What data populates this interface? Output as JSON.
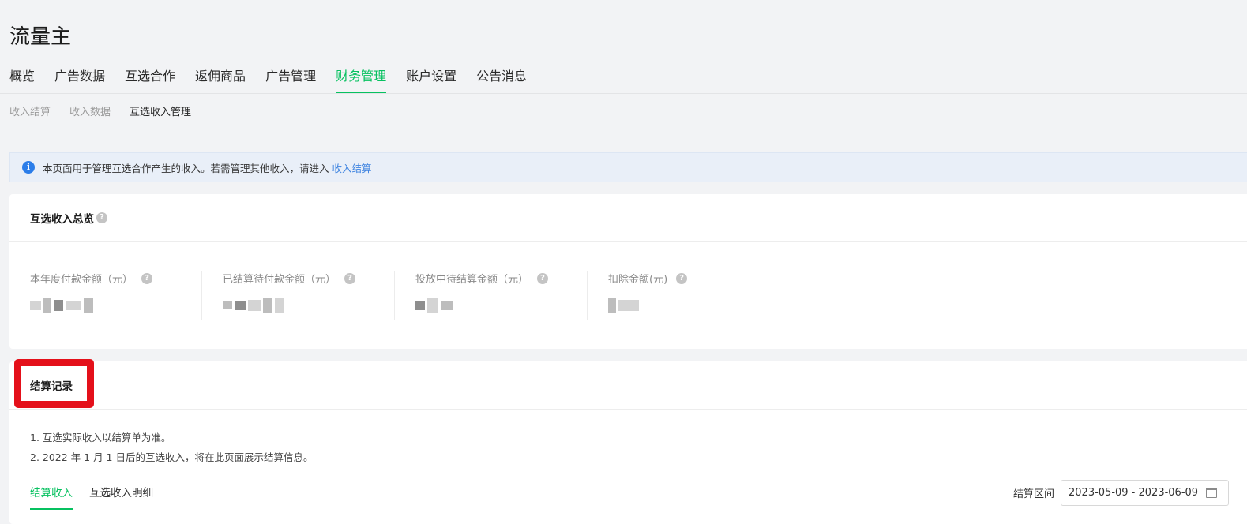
{
  "app_title": "流量主",
  "main_nav": {
    "tabs": [
      {
        "label": "概览",
        "active": false
      },
      {
        "label": "广告数据",
        "active": false
      },
      {
        "label": "互选合作",
        "active": false
      },
      {
        "label": "返佣商品",
        "active": false
      },
      {
        "label": "广告管理",
        "active": false
      },
      {
        "label": "财务管理",
        "active": true
      },
      {
        "label": "账户设置",
        "active": false
      },
      {
        "label": "公告消息",
        "active": false
      }
    ]
  },
  "sub_nav": {
    "items": [
      {
        "label": "收入结算",
        "active": false
      },
      {
        "label": "收入数据",
        "active": false
      },
      {
        "label": "互选收入管理",
        "active": true
      }
    ]
  },
  "notice": {
    "icon": "info-icon",
    "text": "本页面用于管理互选合作产生的收入。若需管理其他收入，请进入",
    "link": "收入结算"
  },
  "overview": {
    "title": "互选收入总览",
    "stats": [
      {
        "label": "本年度付款金额（元）"
      },
      {
        "label": "已结算待付款金额（元）"
      },
      {
        "label": "投放中待结算金额（元）"
      },
      {
        "label": "扣除金额(元)"
      }
    ]
  },
  "records": {
    "title": "结算记录",
    "notes": [
      "1. 互选实际收入以结算单为准。",
      "2. 2022 年 1 月 1 日后的互选收入，将在此页面展示结算信息。"
    ],
    "tabs": [
      {
        "label": "结算收入",
        "active": true
      },
      {
        "label": "互选收入明细",
        "active": false
      }
    ],
    "date_range_label": "结算区间",
    "date_range_value": "2023-05-09 - 2023-06-09"
  },
  "colors": {
    "accent": "#07c160",
    "link": "#3f84e0",
    "highlight": "#e4101a"
  }
}
